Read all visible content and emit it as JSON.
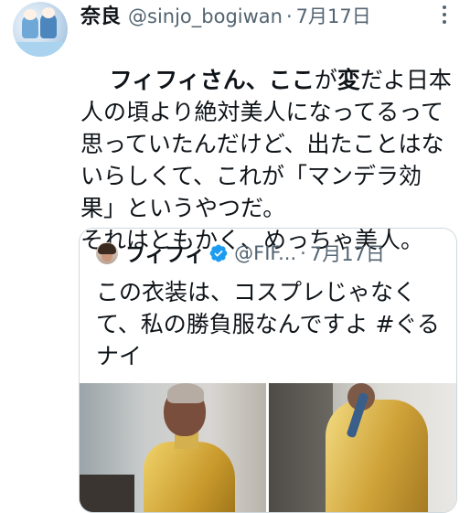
{
  "tweet": {
    "author_name": "奈良",
    "author_handle": "@sinjo_bogiwan",
    "separator": "·",
    "date": "7月17日",
    "text_segments": [
      {
        "text": "フィフィさん、",
        "bold": true
      },
      {
        "text": "ここ",
        "bold": true
      },
      {
        "text": "が",
        "bold": false
      },
      {
        "text": "変",
        "bold": true
      },
      {
        "text": "だよ日本人の頃より絶対美人になってるって思っていたんだけど、出たことはないらしくて、これが「マンデラ効果」というやつだ。\nそれはともかく、めっちゃ美人。",
        "bold": false
      }
    ]
  },
  "quoted_tweet": {
    "author_name": "フィフィ",
    "author_handle": "@FIF...",
    "separator": "·",
    "date": "7月17日",
    "text": "この衣装は、コスプレじゃなくて、私の勝負服なんですよ #ぐるナイ",
    "verified": true
  },
  "icons": {
    "more": "more-vertical-icon",
    "verified": "verified-badge-icon"
  },
  "colors": {
    "text": "#0f1419",
    "secondary": "#536471",
    "border": "#cfd9de",
    "verified": "#1d9bf0"
  }
}
